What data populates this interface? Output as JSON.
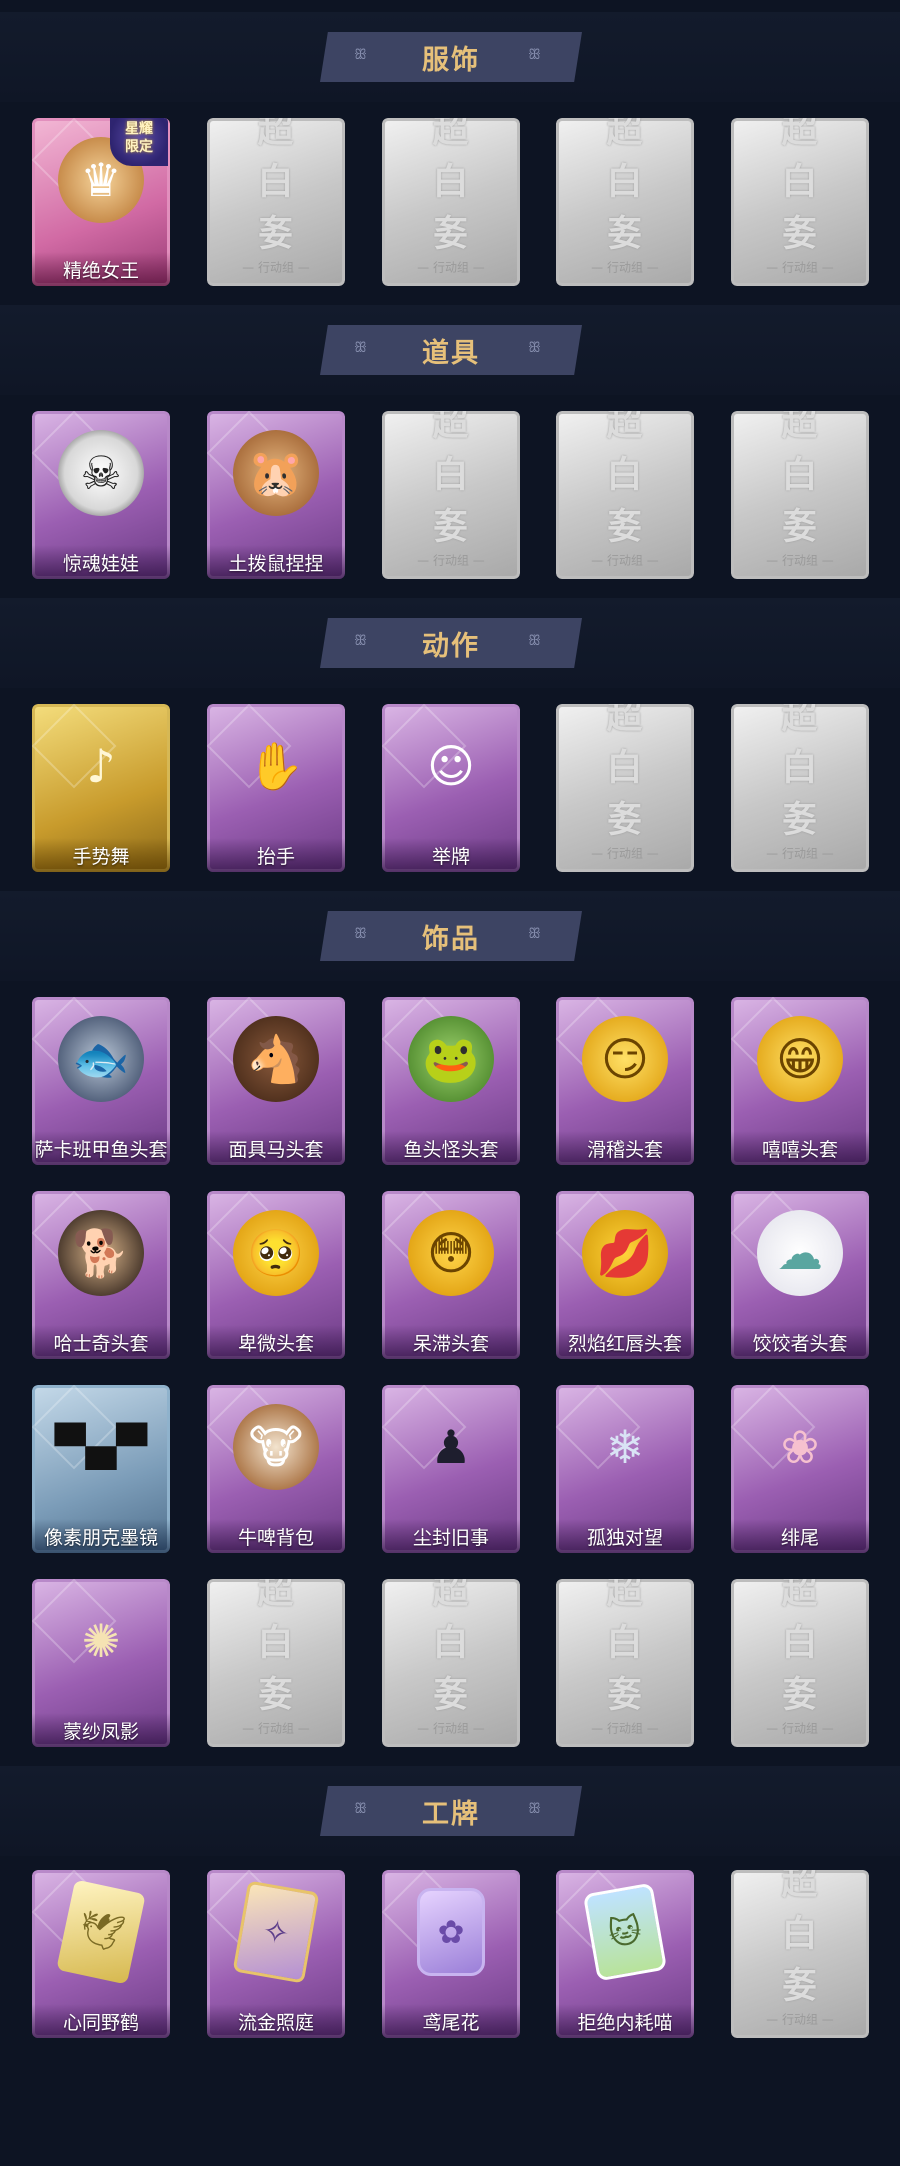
{
  "empty_card": {
    "title": "超白㚣",
    "subtitle": "— 行动组 —"
  },
  "sections": {
    "costume": {
      "title": "服饰",
      "items": [
        {
          "label": "精绝女王",
          "icon": "queen-portrait-icon",
          "badge": "星耀\n限定",
          "theme": "pink"
        }
      ]
    },
    "props": {
      "title": "道具",
      "items": [
        {
          "label": "惊魂娃娃",
          "icon": "skull-doll-icon",
          "theme": "purple"
        },
        {
          "label": "土拨鼠捏捏",
          "icon": "hamster-icon",
          "theme": "purple"
        }
      ]
    },
    "actions": {
      "title": "动作",
      "items": [
        {
          "label": "手势舞",
          "icon": "gesture-dance-icon",
          "theme": "gold"
        },
        {
          "label": "抬手",
          "icon": "raise-hand-icon",
          "theme": "purple"
        },
        {
          "label": "举牌",
          "icon": "hold-sign-icon",
          "theme": "purple"
        }
      ]
    },
    "accessories": {
      "title": "饰品",
      "items": [
        {
          "label": "萨卡班甲鱼头套",
          "icon": "fish-head-icon",
          "theme": "purple"
        },
        {
          "label": "面具马头套",
          "icon": "horse-head-icon",
          "theme": "purple"
        },
        {
          "label": "鱼头怪头套",
          "icon": "fish-monster-head-icon",
          "theme": "purple"
        },
        {
          "label": "滑稽头套",
          "icon": "funny-face-icon",
          "theme": "purple"
        },
        {
          "label": "嘻嘻头套",
          "icon": "grin-face-icon",
          "theme": "purple"
        },
        {
          "label": "哈士奇头套",
          "icon": "husky-head-icon",
          "theme": "purple"
        },
        {
          "label": "卑微头套",
          "icon": "humble-face-icon",
          "theme": "purple"
        },
        {
          "label": "呆滞头套",
          "icon": "dazed-face-icon",
          "theme": "purple"
        },
        {
          "label": "烈焰红唇头套",
          "icon": "red-lips-head-icon",
          "theme": "purple"
        },
        {
          "label": "饺饺者头套",
          "icon": "dumpling-head-icon",
          "theme": "purple"
        },
        {
          "label": "像素朋克墨镜",
          "icon": "pixel-sunglasses-icon",
          "theme": "blue"
        },
        {
          "label": "牛啤背包",
          "icon": "cow-beer-backpack-icon",
          "theme": "purple"
        },
        {
          "label": "尘封旧事",
          "icon": "chibi-charm-icon",
          "theme": "purple"
        },
        {
          "label": "孤独对望",
          "icon": "lonely-charm-icon",
          "theme": "purple"
        },
        {
          "label": "绯尾",
          "icon": "fox-tail-charm-icon",
          "theme": "purple"
        },
        {
          "label": "蒙纱凤影",
          "icon": "phoenix-charm-icon",
          "theme": "purple"
        }
      ]
    },
    "badges": {
      "title": "工牌",
      "items": [
        {
          "label": "心同野鹤",
          "icon": "crane-card-icon",
          "theme": "purple"
        },
        {
          "label": "流金照庭",
          "icon": "golden-court-card-icon",
          "theme": "purple"
        },
        {
          "label": "鸢尾花",
          "icon": "iris-card-icon",
          "theme": "purple"
        },
        {
          "label": "拒绝内耗喵",
          "icon": "cat-card-icon",
          "theme": "purple"
        }
      ]
    }
  }
}
